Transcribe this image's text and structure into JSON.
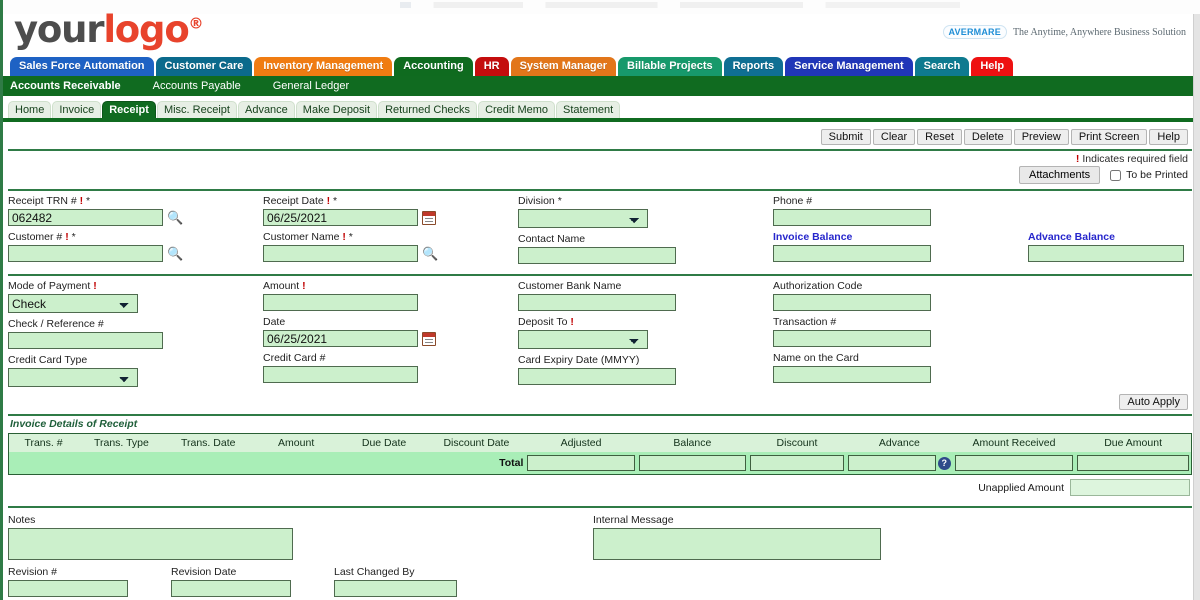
{
  "brand": {
    "logo_your": "your",
    "logo_logo": "logo",
    "logo_reg": "®",
    "vendor_mark": "AVERMARE",
    "vendor_tagline": "The Anytime, Anywhere Business Solution"
  },
  "main_nav": [
    {
      "label": "Sales Force Automation",
      "color": "#1e62c4"
    },
    {
      "label": "Customer Care",
      "color": "#0b6a8c"
    },
    {
      "label": "Inventory Management",
      "color": "#f07c12"
    },
    {
      "label": "Accounting",
      "color": "#0f6b1f"
    },
    {
      "label": "HR",
      "color": "#c40d0d"
    },
    {
      "label": "System Manager",
      "color": "#e2761a"
    },
    {
      "label": "Billable Projects",
      "color": "#17996b"
    },
    {
      "label": "Reports",
      "color": "#0f6f93"
    },
    {
      "label": "Service Management",
      "color": "#2036b8"
    },
    {
      "label": "Search",
      "color": "#0e7a8f"
    },
    {
      "label": "Help",
      "color": "#ee1111"
    }
  ],
  "sub_nav": [
    {
      "label": "Accounts Receivable",
      "active": true
    },
    {
      "label": "Accounts Payable",
      "active": false
    },
    {
      "label": "General Ledger",
      "active": false
    }
  ],
  "tabs": [
    {
      "label": "Home",
      "active": false
    },
    {
      "label": "Invoice",
      "active": false
    },
    {
      "label": "Receipt",
      "active": true
    },
    {
      "label": "Misc. Receipt",
      "active": false
    },
    {
      "label": "Advance",
      "active": false
    },
    {
      "label": "Make Deposit",
      "active": false
    },
    {
      "label": "Returned Checks",
      "active": false
    },
    {
      "label": "Credit Memo",
      "active": false
    },
    {
      "label": "Statement",
      "active": false
    }
  ],
  "toolbar": {
    "submit": "Submit",
    "clear": "Clear",
    "reset": "Reset",
    "delete": "Delete",
    "preview": "Preview",
    "print_screen": "Print Screen",
    "help": "Help",
    "required_note_bang": "!",
    "required_note": "Indicates required field",
    "attachments": "Attachments",
    "to_be_printed": "To be Printed",
    "to_be_printed_checked": false
  },
  "section1": {
    "receipt_trn": {
      "label": "Receipt TRN #",
      "bang": "!",
      "star": "*",
      "value": "062482"
    },
    "customer_no": {
      "label": "Customer #",
      "bang": "!",
      "star": "*",
      "value": ""
    },
    "receipt_date": {
      "label": "Receipt Date",
      "bang": "!",
      "star": "*",
      "value": "06/25/2021"
    },
    "customer_name": {
      "label": "Customer Name",
      "bang": "!",
      "star": "*",
      "value": ""
    },
    "division": {
      "label": "Division",
      "star": "*",
      "value": ""
    },
    "contact_name": {
      "label": "Contact Name",
      "value": ""
    },
    "phone": {
      "label": "Phone #",
      "value": ""
    },
    "invoice_balance": {
      "label": "Invoice Balance",
      "value": ""
    },
    "advance_balance": {
      "label": "Advance Balance",
      "value": ""
    }
  },
  "section2": {
    "mode_of_payment": {
      "label": "Mode of Payment",
      "bang": "!",
      "value": "Check"
    },
    "check_reference": {
      "label": "Check / Reference #",
      "value": ""
    },
    "credit_card_type": {
      "label": "Credit Card Type",
      "value": ""
    },
    "amount": {
      "label": "Amount",
      "bang": "!",
      "value": ""
    },
    "date": {
      "label": "Date",
      "value": "06/25/2021"
    },
    "credit_card_no": {
      "label": "Credit Card #",
      "value": ""
    },
    "customer_bank_name": {
      "label": "Customer Bank Name",
      "value": ""
    },
    "deposit_to": {
      "label": "Deposit To",
      "bang": "!",
      "value": ""
    },
    "card_expiry": {
      "label": "Card Expiry Date (MMYY)",
      "value": ""
    },
    "authorization_code": {
      "label": "Authorization Code",
      "value": ""
    },
    "transaction_no": {
      "label": "Transaction #",
      "value": ""
    },
    "name_on_card": {
      "label": "Name on the Card",
      "value": ""
    }
  },
  "invoice_details": {
    "auto_apply": "Auto Apply",
    "title": "Invoice Details of Receipt",
    "columns": [
      "Trans. #",
      "Trans. Type",
      "Trans. Date",
      "Amount",
      "Due Date",
      "Discount Date",
      "Adjusted",
      "Balance",
      "Discount",
      "Advance",
      "Amount Received",
      "Due Amount"
    ],
    "total_label": "Total",
    "totals": {
      "adjusted": "",
      "balance": "",
      "discount": "",
      "advance": "",
      "amount_received": "",
      "due_amount": ""
    },
    "help_icon": "?",
    "unapplied_label": "Unapplied Amount",
    "unapplied_value": ""
  },
  "footer": {
    "notes_label": "Notes",
    "notes_value": "",
    "internal_message_label": "Internal Message",
    "internal_message_value": "",
    "revision_no_label": "Revision #",
    "revision_no_value": "",
    "revision_date_label": "Revision Date",
    "revision_date_value": "",
    "last_changed_by_label": "Last Changed By",
    "last_changed_by_value": ""
  },
  "icons": {
    "search": "search-icon",
    "calendar": "calendar-icon"
  }
}
